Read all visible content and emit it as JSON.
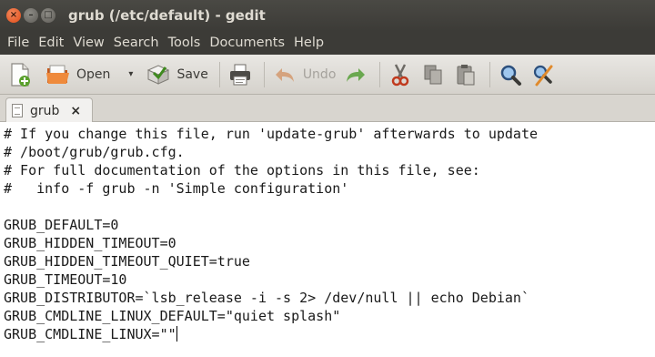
{
  "window": {
    "title": "grub (/etc/default) - gedit",
    "close_glyph": "×",
    "minimize_glyph": "–",
    "maximize_glyph": "□"
  },
  "menubar": {
    "items": [
      "File",
      "Edit",
      "View",
      "Search",
      "Tools",
      "Documents",
      "Help"
    ]
  },
  "toolbar": {
    "new_icon": "new-document-icon",
    "open_label": "Open",
    "open_dropdown_glyph": "▾",
    "save_label": "Save",
    "print_icon": "print-icon",
    "undo_label": "Undo",
    "redo_icon": "redo-icon",
    "cut_icon": "cut-icon",
    "copy_icon": "copy-icon",
    "paste_icon": "paste-icon",
    "find_icon": "find-icon",
    "replace_icon": "find-replace-icon"
  },
  "tab": {
    "label": "grub",
    "close_glyph": "×"
  },
  "editor": {
    "lines": [
      "# If you change this file, run 'update-grub' afterwards to update",
      "# /boot/grub/grub.cfg.",
      "# For full documentation of the options in this file, see:",
      "#   info -f grub -n 'Simple configuration'",
      "",
      "GRUB_DEFAULT=0",
      "GRUB_HIDDEN_TIMEOUT=0",
      "GRUB_HIDDEN_TIMEOUT_QUIET=true",
      "GRUB_TIMEOUT=10",
      "GRUB_DISTRIBUTOR=`lsb_release -i -s 2> /dev/null || echo Debian`",
      "GRUB_CMDLINE_LINUX_DEFAULT=\"quiet splash\"",
      "GRUB_CMDLINE_LINUX=\"\""
    ]
  },
  "colors": {
    "accent_close": "#df4a16",
    "chrome_dark": "#3c3b37",
    "toolbar_bg": "#dcd9d4"
  }
}
